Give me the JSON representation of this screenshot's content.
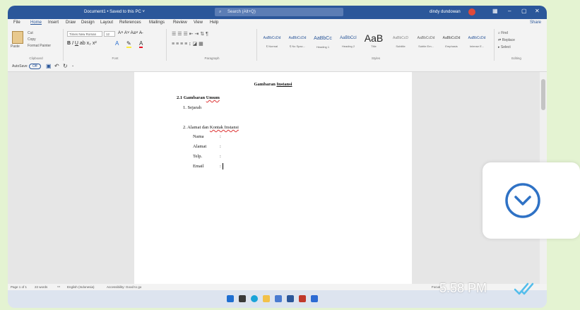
{
  "window": {
    "title": "Document1 • Saved to this PC ˅",
    "search_placeholder": "Search (Alt+Q)",
    "user_name": "dindy dundowan"
  },
  "menu": {
    "tabs": [
      "File",
      "Home",
      "Insert",
      "Draw",
      "Design",
      "Layout",
      "References",
      "Mailings",
      "Review",
      "View",
      "Help"
    ],
    "share_label": "Share"
  },
  "ribbon": {
    "clipboard": {
      "paste": "Paste",
      "cut": "Cut",
      "copy": "Copy",
      "format_painter": "Format Painter",
      "label": "Clipboard"
    },
    "font": {
      "name": "Times New Roman",
      "size": "12",
      "label": "Font"
    },
    "paragraph": {
      "label": "Paragraph"
    },
    "styles": {
      "label": "Styles",
      "items": [
        {
          "sample": "AaBbCcDd",
          "name": "¶ Normal"
        },
        {
          "sample": "AaBbCcDd",
          "name": "¶ No Spac..."
        },
        {
          "sample": "AaBbCc",
          "name": "Heading 1"
        },
        {
          "sample": "AaBbCcI",
          "name": "Heading 2"
        },
        {
          "sample": "AaB",
          "name": "Title"
        },
        {
          "sample": "AaBbCcD",
          "name": "Subtitle"
        },
        {
          "sample": "AaBbCcDd",
          "name": "Subtle Em..."
        },
        {
          "sample": "AaBbCcDd",
          "name": "Emphasis"
        },
        {
          "sample": "AaBbCcDd",
          "name": "Intense E..."
        }
      ]
    },
    "editing": {
      "find": "Find",
      "replace": "Replace",
      "select": "Select",
      "label": "Editing"
    }
  },
  "quick_access": {
    "autosave": "AutoSave",
    "toggle": "Off"
  },
  "document": {
    "title_plain": "Gambaran ",
    "title_link": "Instansi",
    "section_number": "2.1 Gambaran ",
    "section_link": "Umum",
    "item1": "1.   Sejarah",
    "item2_prefix": "2.   Alamat dan ",
    "item2_link": "Kontak Instansi",
    "fields": [
      {
        "label": "Nama",
        "sep": ":"
      },
      {
        "label": "Alamat",
        "sep": ":"
      },
      {
        "label": "Telp.",
        "sep": ":"
      },
      {
        "label": "Email",
        "sep": ":"
      }
    ]
  },
  "status_bar": {
    "page": "Page 1 of 1",
    "words": "22 words",
    "language": "English (Indonesia)",
    "accessibility": "Accessibility: Good to go",
    "focus": "Focus"
  },
  "overlay": {
    "timestamp": "5.58 PM"
  },
  "colors": {
    "word_blue": "#2b579a",
    "chat_bg": "#e4f3d2",
    "read_ticks": "#53bdeb"
  }
}
